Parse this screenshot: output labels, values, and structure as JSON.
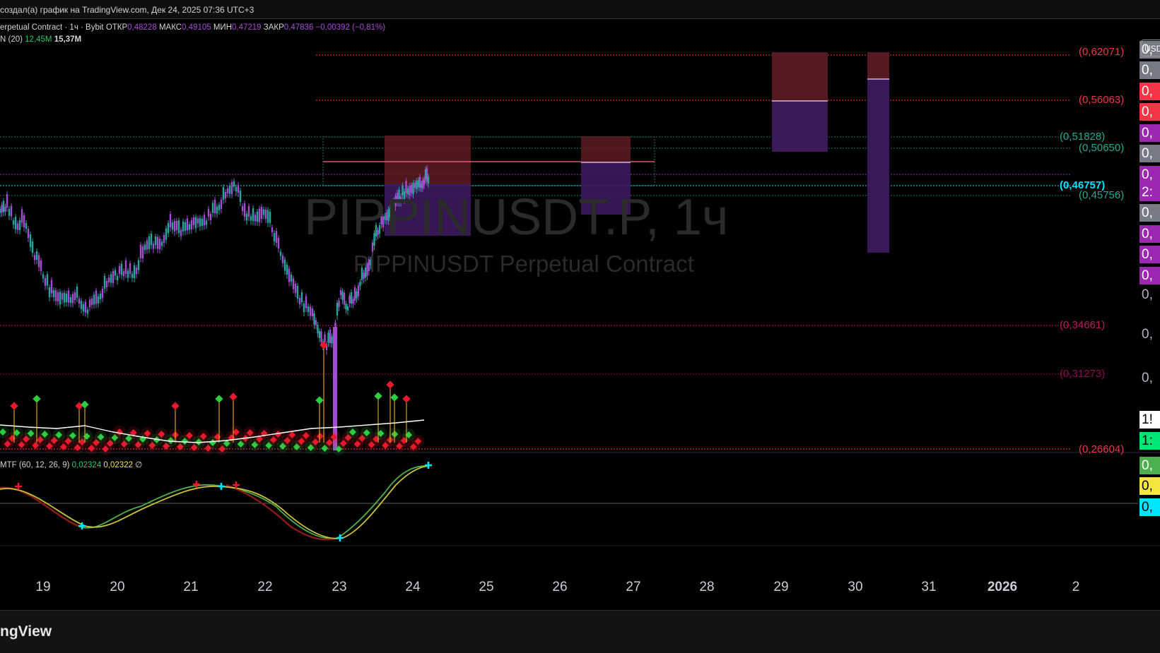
{
  "header": {
    "title": "создал(а) график на TradingView.com, Дек 24, 2025 07:36 UTC+3"
  },
  "legend": {
    "symbol_line": "erpetual Contract · 1ч · Bybit",
    "open_label": "ОТКР",
    "open_value": "0,48228",
    "high_label": "МАКС",
    "high_value": "0,49105",
    "low_label": "МИН",
    "low_value": "0,47219",
    "close_label": "ЗАКР",
    "close_value": "0,47836",
    "change": "−0,00392 (−0,81%)",
    "volume_name": "N (20)",
    "volume_value": "12,45M",
    "volume_ma": "15,37M",
    "macd_name": "MTF (60, 12, 26, 9)",
    "macd_value1": "0,02324",
    "macd_value2": "0,02322",
    "macd_value3": "∅"
  },
  "watermark": {
    "symbol": "PIPPINUSDT.P, 1ч",
    "description": "PIPPINUSDT Perpetual Contract"
  },
  "currency_button": "USD",
  "price_levels": [
    {
      "label": "(0,62071)",
      "color": "#f23645"
    },
    {
      "label": "(0,56063)",
      "color": "#f23645"
    },
    {
      "label": "(0,51828)",
      "color": "#22ab94"
    },
    {
      "label": "(0,50650)",
      "color": "#22ab94"
    },
    {
      "label": "(0,46757)",
      "color": "#00e5ff"
    },
    {
      "label": "(0,45756)",
      "color": "#22ab94"
    },
    {
      "label": "(0,34661)",
      "color": "#c2185b"
    },
    {
      "label": "(0,31273)",
      "color": "#880e4f"
    },
    {
      "label": "(0,26604)",
      "color": "#f23645"
    }
  ],
  "axis_labels": [
    {
      "text": "0,",
      "bg": "#787b86",
      "fg": "#ffffff"
    },
    {
      "text": "0,",
      "bg": "#787b86",
      "fg": "#ffffff"
    },
    {
      "text": "0,",
      "bg": "#f23645",
      "fg": "#ffffff"
    },
    {
      "text": "0,",
      "bg": "#f23645",
      "fg": "#ffffff"
    },
    {
      "text": "0,",
      "bg": "#9c27b0",
      "fg": "#ffffff"
    },
    {
      "text": "0,",
      "bg": "#787b86",
      "fg": "#ffffff"
    },
    {
      "text": "0,",
      "bg": "#9c27b0",
      "fg": "#ffffff"
    },
    {
      "text": "2:",
      "bg": "#9c27b0",
      "fg": "#ffffff"
    },
    {
      "text": "0,",
      "bg": "#787b86",
      "fg": "#ffffff"
    },
    {
      "text": "0,",
      "bg": "#9c27b0",
      "fg": "#ffffff"
    },
    {
      "text": "0,",
      "bg": "#9c27b0",
      "fg": "#ffffff"
    },
    {
      "text": "0,",
      "bg": "#9c27b0",
      "fg": "#ffffff"
    },
    {
      "text": "0,",
      "bg": "transparent",
      "fg": "#b2b5be"
    },
    {
      "text": "0,",
      "bg": "transparent",
      "fg": "#b2b5be"
    },
    {
      "text": "0,",
      "bg": "transparent",
      "fg": "#b2b5be"
    },
    {
      "text": "1!",
      "bg": "#ffffff",
      "fg": "#000000"
    },
    {
      "text": "1:",
      "bg": "#00e676",
      "fg": "#000000"
    },
    {
      "text": "0,",
      "bg": "#4caf50",
      "fg": "#ffffff"
    },
    {
      "text": "0,",
      "bg": "#f5e642",
      "fg": "#000000"
    },
    {
      "text": "0,",
      "bg": "#00e5ff",
      "fg": "#000000"
    }
  ],
  "x_axis": [
    "19",
    "20",
    "21",
    "22",
    "23",
    "24",
    "25",
    "26",
    "27",
    "28",
    "29",
    "30",
    "31",
    "2026",
    "2"
  ],
  "footer": {
    "brand": "ngView"
  },
  "colors": {
    "up": "#26a69a",
    "down": "#a64bd6",
    "bg": "#000000",
    "macd": "#4caf50",
    "signal": "#c9c23a"
  }
}
